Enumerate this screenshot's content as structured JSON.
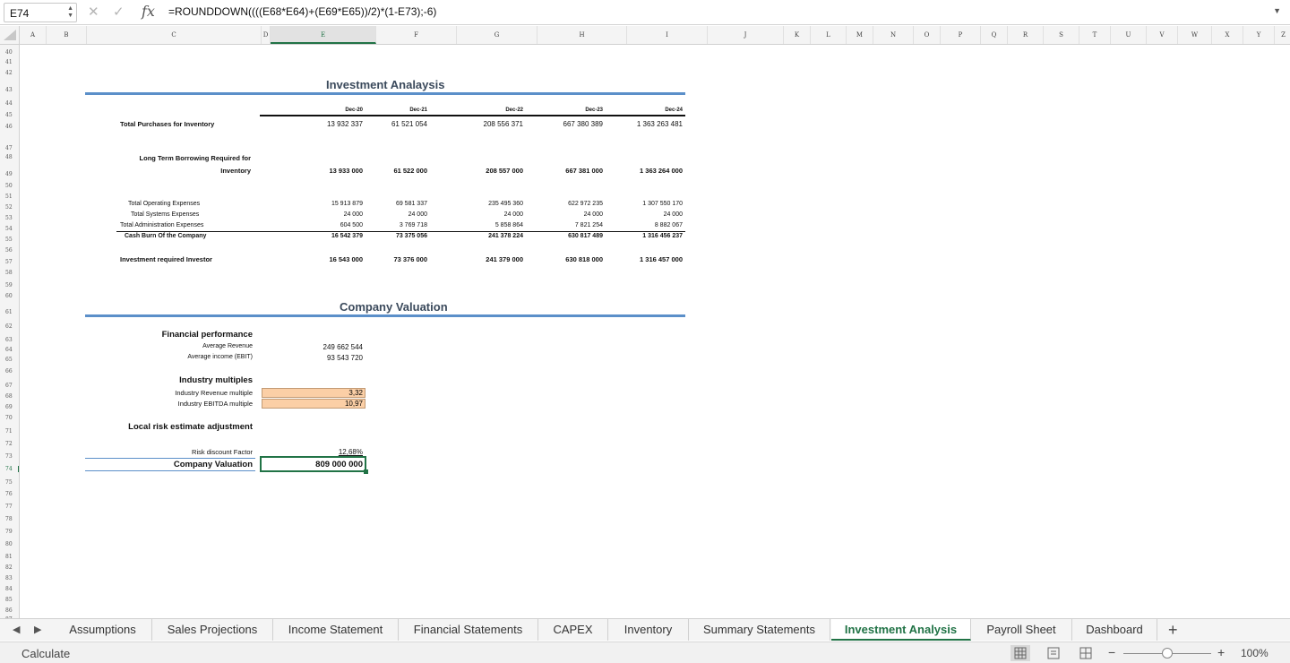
{
  "formula_bar": {
    "name_box": "E74",
    "fx_label": "fx",
    "formula": "=ROUNDDOWN((((E68*E64)+(E69*E65))/2)*(1-E73);-6)",
    "cancel_icon": "close-icon",
    "confirm_icon": "check-icon"
  },
  "columns": [
    "A",
    "B",
    "C",
    "D",
    "E",
    "F",
    "G",
    "H",
    "I",
    "J",
    "K",
    "L",
    "M",
    "N",
    "O",
    "P",
    "Q",
    "R",
    "S",
    "T",
    "U",
    "V",
    "W",
    "X",
    "Y",
    "Z"
  ],
  "selected_column": "E",
  "rows": [
    "40",
    "41",
    "42",
    "43",
    "44",
    "45",
    "46",
    "47",
    "48",
    "49",
    "50",
    "51",
    "52",
    "53",
    "54",
    "55",
    "56",
    "57",
    "58",
    "59",
    "60",
    "61",
    "62",
    "63",
    "64",
    "65",
    "66",
    "67",
    "68",
    "69",
    "70",
    "71",
    "72",
    "73",
    "74",
    "75",
    "76",
    "77",
    "78",
    "79",
    "80",
    "81",
    "82",
    "83",
    "84",
    "85",
    "86",
    "87",
    "88"
  ],
  "selected_row": "74",
  "investment": {
    "title": "Investment Analaysis",
    "dates": [
      "Dec-20",
      "Dec-21",
      "Dec-22",
      "Dec-23",
      "Dec-24"
    ],
    "purchases_label": "Total Purchases for Inventory",
    "purchases": [
      "13 932 337",
      "61 521 054",
      "208 556 371",
      "667 380 389",
      "1 363 263 481"
    ],
    "borrow_label_1": "Long Term Borrowing Required for",
    "borrow_label_2": "Inventory",
    "borrow": [
      "13 933 000",
      "61 522 000",
      "208 557 000",
      "667 381 000",
      "1 363 264 000"
    ],
    "opex_label": "Total Operating Expenses",
    "opex": [
      "15 913 879",
      "69 581 337",
      "235 495 360",
      "622 972 235",
      "1 307 550 170"
    ],
    "sys_label": "Total Systems Expenses",
    "sys": [
      "24 000",
      "24 000",
      "24 000",
      "24 000",
      "24 000"
    ],
    "admin_label": "Total Administration Expenses",
    "admin": [
      "604 500",
      "3 769 718",
      "5 858 864",
      "7 821 254",
      "8 882 067"
    ],
    "burn_label": "Cash Burn Of the Company",
    "burn": [
      "16 542 379",
      "73 375 056",
      "241 378 224",
      "630 817 489",
      "1 316 456 237"
    ],
    "investor_label": "Investment required Investor",
    "investor": [
      "16 543 000",
      "73 376 000",
      "241 379 000",
      "630 818 000",
      "1 316 457 000"
    ]
  },
  "valuation": {
    "title": "Company Valuation",
    "fin_perf_label": "Financial performance",
    "avg_rev_label": "Average Revenue",
    "avg_rev": "249 662 544",
    "avg_inc_label": "Average income (EBIT)",
    "avg_inc": "93 543 720",
    "ind_mult_label": "Industry multiples",
    "rev_mult_label": "Industry Revenue multiple",
    "rev_mult": "3,32",
    "ebitda_mult_label": "Industry EBITDA multiple",
    "ebitda_mult": "10,97",
    "local_risk_label": "Local risk estimate adjustment",
    "risk_label": "Risk discount Factor",
    "risk": "12,68%",
    "company_val_label": "Company Valuation",
    "company_val": "809 000 000"
  },
  "tabs": [
    {
      "label": "Assumptions",
      "active": false
    },
    {
      "label": "Sales Projections",
      "active": false
    },
    {
      "label": "Income Statement",
      "active": false
    },
    {
      "label": "Financial Statements",
      "active": false
    },
    {
      "label": "CAPEX",
      "active": false
    },
    {
      "label": "Inventory",
      "active": false
    },
    {
      "label": "Summary Statements",
      "active": false
    },
    {
      "label": "Investment Analysis",
      "active": true
    },
    {
      "label": "Payroll Sheet",
      "active": false
    },
    {
      "label": "Dashboard",
      "active": false
    }
  ],
  "status_bar": {
    "text": "Calculate",
    "zoom": "100%",
    "zoom_level_percent": 100
  },
  "colors": {
    "accent": "#217346",
    "section_rule": "#5b8fc9",
    "input_fill": "#fbcfa6"
  }
}
